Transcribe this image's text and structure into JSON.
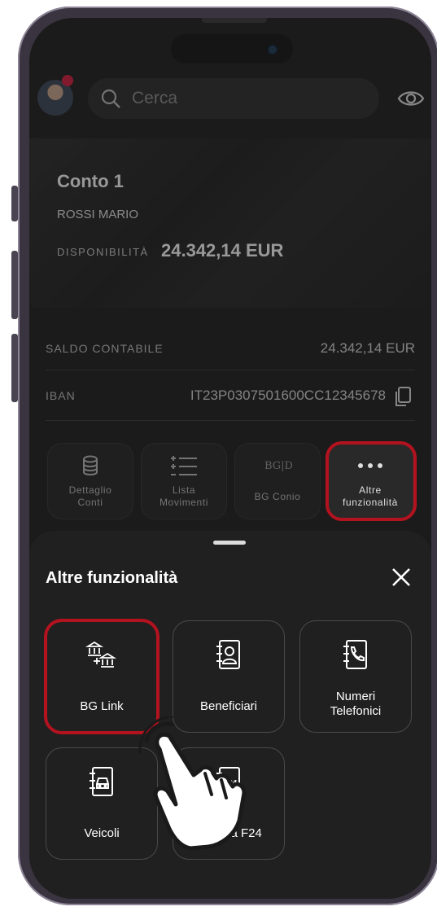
{
  "header": {
    "search_placeholder": "Cerca"
  },
  "account": {
    "name": "Conto 1",
    "holder": "ROSSI MARIO",
    "availability_label": "DISPONIBILITÀ",
    "availability_value": "24.342,14 EUR"
  },
  "details": {
    "balance_label": "SALDO CONTABILE",
    "balance_value": "24.342,14 EUR",
    "iban_label": "IBAN",
    "iban_value": "IT23P0307501600CC12345678"
  },
  "quick_actions": [
    {
      "line1": "Dettaglio",
      "line2": "Conti",
      "icon": "database-icon"
    },
    {
      "line1": "Lista",
      "line2": "Movimenti",
      "icon": "list-icon"
    },
    {
      "line1": "BG Conio",
      "line2": "",
      "icon": "bgconio-icon"
    },
    {
      "line1": "Altre",
      "line2": "funzionalità",
      "icon": "more-dots-icon"
    }
  ],
  "sheet": {
    "title": "Altre funzionalità",
    "tiles": [
      {
        "line1": "BG Link",
        "line2": "",
        "icon": "bank-link-icon"
      },
      {
        "line1": "Beneficiari",
        "line2": "",
        "icon": "contact-book-icon"
      },
      {
        "line1": "Numeri",
        "line2": "Telefonici",
        "icon": "phone-book-icon"
      },
      {
        "line1": "Veicoli",
        "line2": "",
        "icon": "vehicle-book-icon"
      },
      {
        "line1": "Rubrica F24",
        "line2": "",
        "icon": "f24-book-icon"
      }
    ],
    "f24_icon_text": "F24"
  },
  "colors": {
    "highlight": "#b3121f",
    "notification": "#d81b3f"
  }
}
